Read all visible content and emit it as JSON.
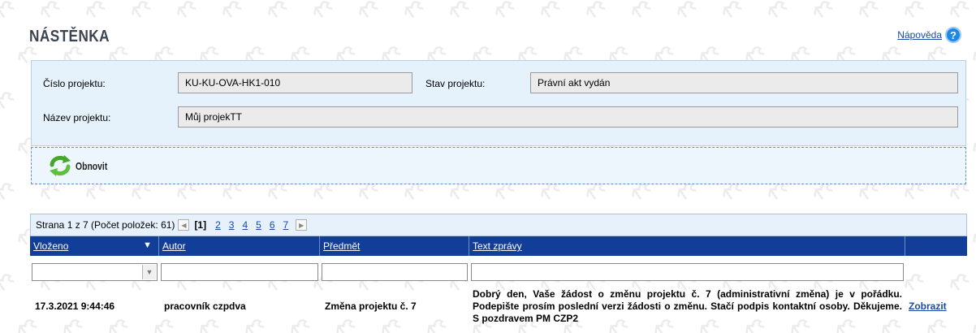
{
  "page": {
    "title": "NÁSTĚNKA",
    "help_label": "Nápověda"
  },
  "project": {
    "number_label": "Číslo projektu:",
    "number_value": "KU-KU-OVA-HK1-010",
    "status_label": "Stav projektu:",
    "status_value": "Právní akt vydán",
    "name_label": "Název projektu:",
    "name_value": "Můj projekTT"
  },
  "toolbar": {
    "refresh_label": "Obnovit"
  },
  "pager": {
    "summary": "Strana 1 z 7 (Počet položek: 61)",
    "current": "[1]",
    "pages": [
      "2",
      "3",
      "4",
      "5",
      "6",
      "7"
    ]
  },
  "grid": {
    "columns": [
      "Vloženo",
      "Autor",
      "Předmět",
      "Text zprávy",
      ""
    ],
    "sort_indicator": "▼",
    "rows": [
      {
        "inserted": "17.3.2021 9:44:46",
        "author": "pracovník czpdva",
        "subject": "Změna projektu č. 7",
        "text": "Dobrý den, Vaše žádost o změnu projektu č. 7 (administrativní změna) je v pořádku. Podepište prosím poslední verzi žádosti o změnu. Stačí podpis kontaktní osoby. Děkujeme. S pozdravem PM CZP2",
        "action": "Zobrazit"
      }
    ]
  },
  "colors": {
    "accent": "#123e9a",
    "panel": "#e5f1fb",
    "link": "#1a4aa8"
  }
}
